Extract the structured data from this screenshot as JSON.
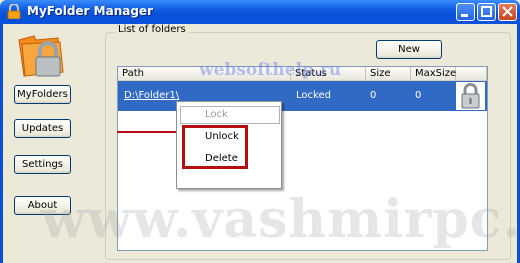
{
  "window": {
    "title": "MyFolder Manager"
  },
  "sidebar": {
    "buttons": [
      {
        "label": "MyFolders"
      },
      {
        "label": "Updates"
      },
      {
        "label": "Settings"
      },
      {
        "label": "About"
      }
    ]
  },
  "main": {
    "group_label": "List of folders",
    "new_label": "New",
    "columns": [
      "Path",
      "Status",
      "Size",
      "MaxSize"
    ],
    "rows": [
      {
        "path": "D:\\Folder1\\",
        "status": "Locked",
        "size": "0",
        "maxsize": "0",
        "icon": "padlock-icon"
      }
    ]
  },
  "context_menu": {
    "items": [
      {
        "label": "Lock",
        "enabled": false
      },
      {
        "label": "Unlock",
        "enabled": true
      },
      {
        "label": "Delete",
        "enabled": true
      }
    ]
  },
  "watermarks": [
    "websofthelp.ru",
    "www.vashmirpc.ru"
  ],
  "colors": {
    "titlebar": "#0a4fd6",
    "selection": "#316ac5",
    "highlight": "#b40e0e"
  }
}
